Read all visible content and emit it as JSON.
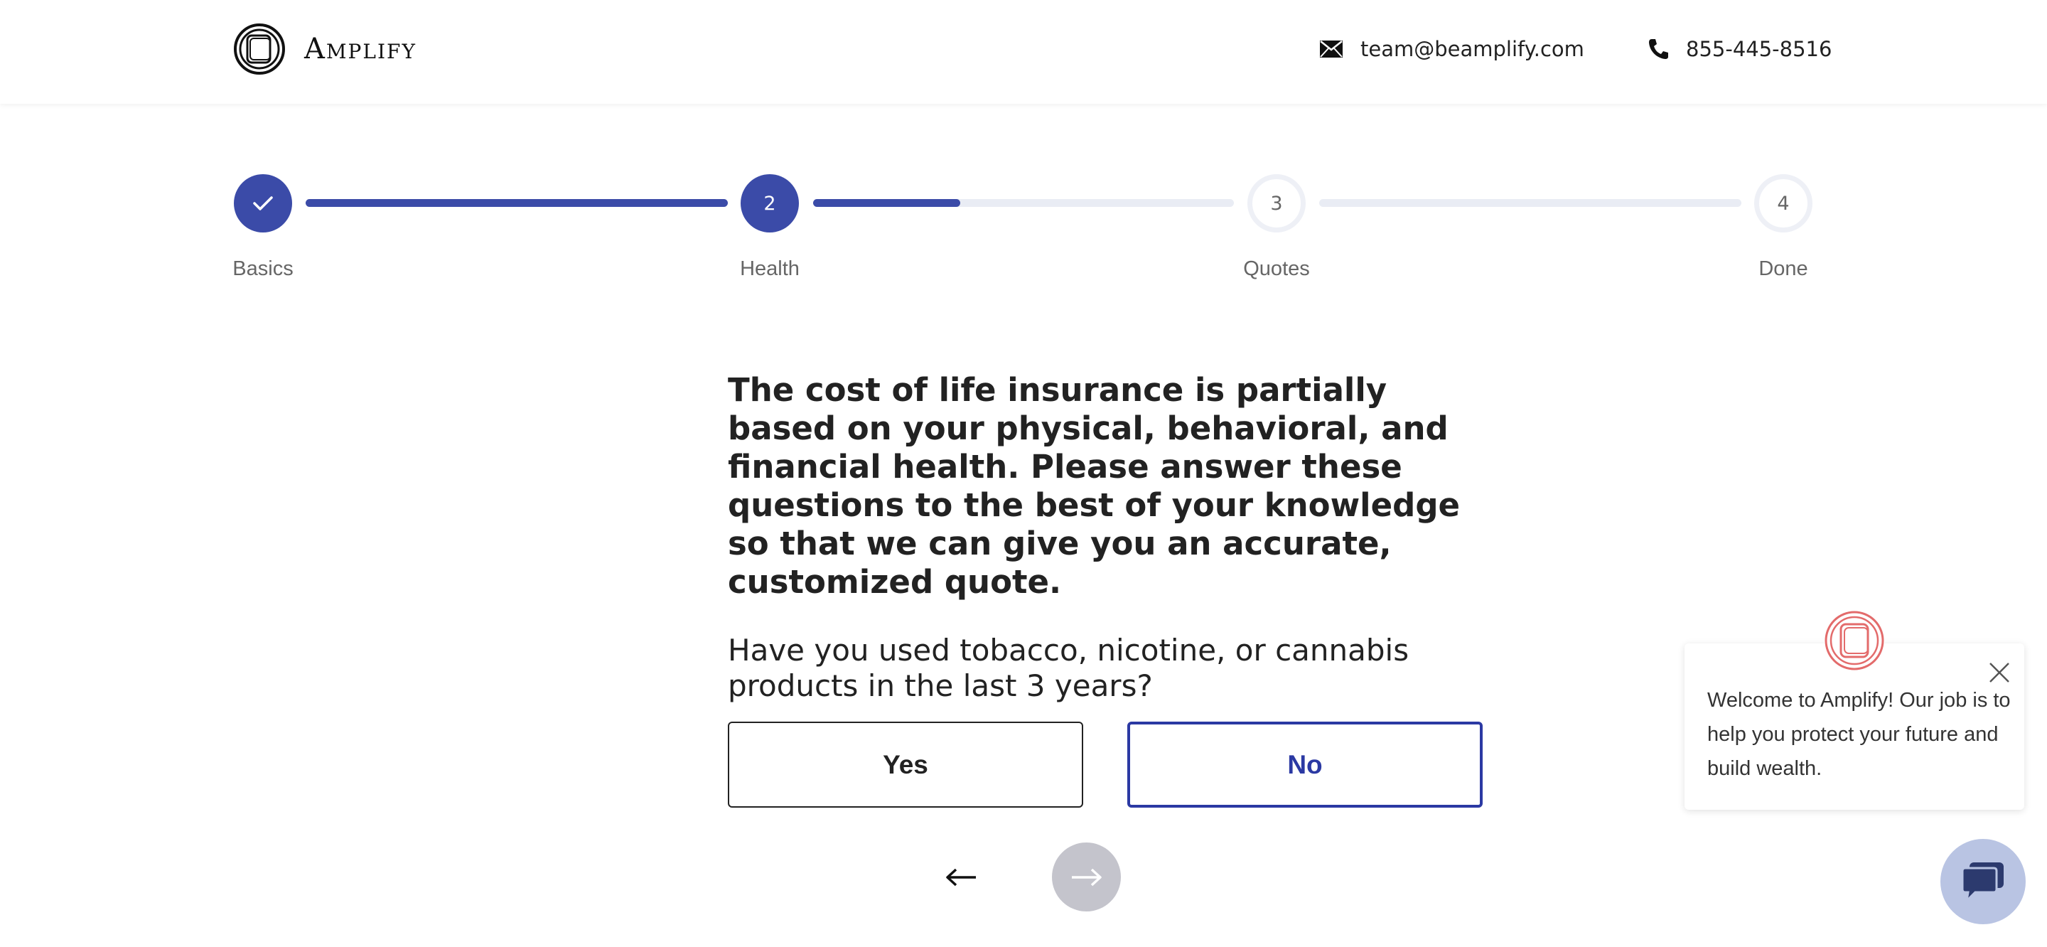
{
  "header": {
    "brand": "Amplify",
    "email": "team@beamplify.com",
    "phone": "855-445-8516",
    "logo_icon": "amplify-logo-icon",
    "email_icon": "envelope-icon",
    "phone_icon": "phone-icon"
  },
  "progress": {
    "steps": [
      {
        "number": "1",
        "label": "Basics",
        "state": "done"
      },
      {
        "number": "2",
        "label": "Health",
        "state": "active"
      },
      {
        "number": "3",
        "label": "Quotes",
        "state": "todo"
      },
      {
        "number": "4",
        "label": "Done",
        "state": "todo"
      }
    ],
    "segments_fill": [
      1.0,
      0.35,
      0.0
    ],
    "accent_color": "#3b4ba8",
    "track_color": "#e9ecf4"
  },
  "main": {
    "intro": "The cost of life insurance is partially based on your physical, behavioral, and financial health. Please answer these questions to the best of your knowledge so that we can give you an accurate, customized quote.",
    "question": "Have you used tobacco, nicotine, or cannabis products in the last 3 years?",
    "answers": {
      "yes": "Yes",
      "no": "No"
    },
    "selected_color": "#2b39a3",
    "back_icon": "arrow-left-icon",
    "next_icon": "arrow-right-icon"
  },
  "chat": {
    "message": "Welcome to Amplify! Our job is to help you protect your future and build wealth.",
    "close_icon": "close-icon",
    "launcher_icon": "chat-icon",
    "launcher_color": "#b9c4e3"
  }
}
